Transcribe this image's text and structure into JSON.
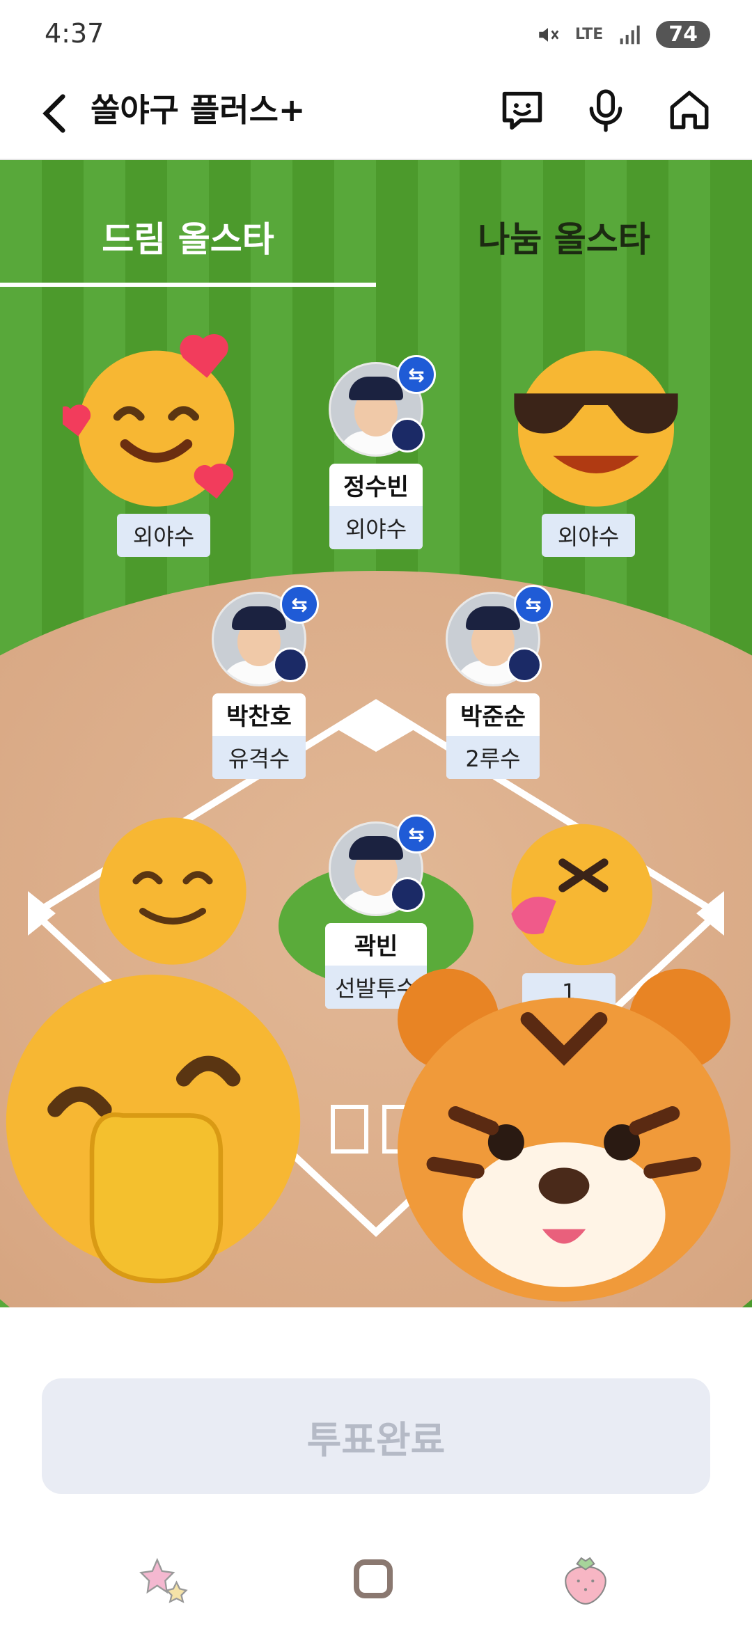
{
  "status_bar": {
    "time": "4:37",
    "battery": "74",
    "network": "LTE"
  },
  "app_bar": {
    "title": "쏠야구 플러스+"
  },
  "icons": {
    "back": "chevron-left-icon",
    "chat": "chat-face-icon",
    "mic": "microphone-icon",
    "home": "home-icon"
  },
  "tabs": [
    {
      "label": "드림 올스타",
      "active": true
    },
    {
      "label": "나눔 올스타",
      "active": false
    }
  ],
  "players": [
    {
      "name": "정수빈",
      "position": "외야수"
    },
    {
      "name": "박찬호",
      "position": "유격수"
    },
    {
      "name": "박준순",
      "position": "2루수"
    },
    {
      "name": "곽빈",
      "position": "선발투수"
    }
  ],
  "partial_positions": {
    "left_outfield": "외야수",
    "right_outfield": "외야수",
    "right_infield": "1"
  },
  "vote_button": "투표완료",
  "colors": {
    "field": "#4f9e2e",
    "dirt": "#d9a985",
    "swap_badge": "#1f5bd6",
    "position_bg": "#dfe9f7"
  }
}
